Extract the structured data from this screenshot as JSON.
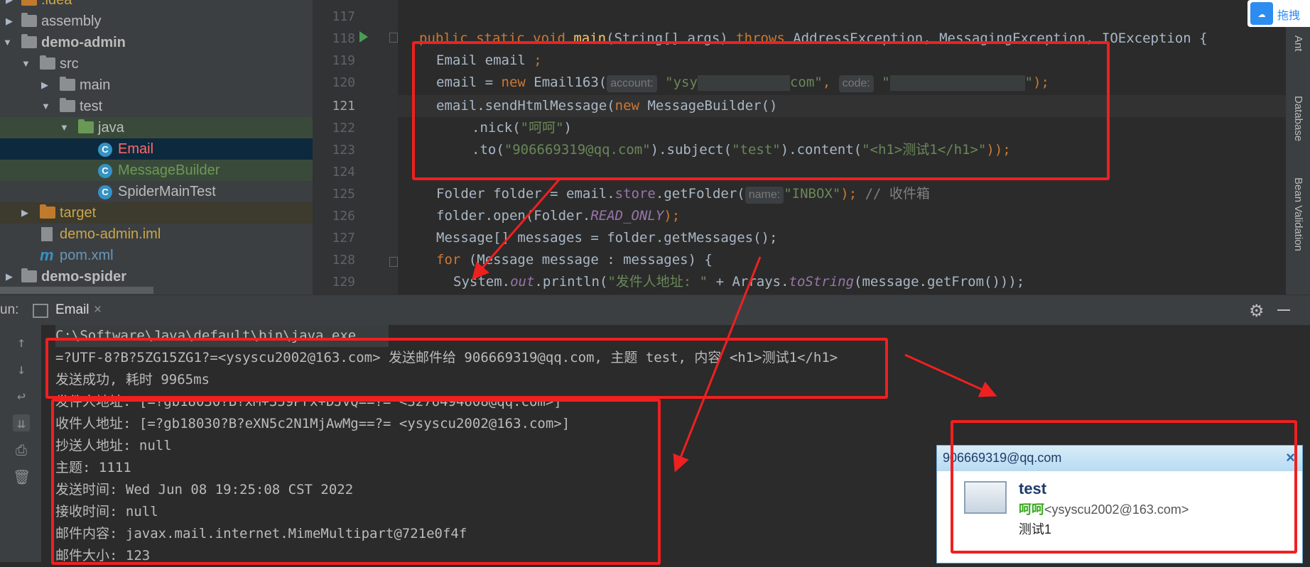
{
  "tree": {
    "items": [
      {
        "label": ".idea"
      },
      {
        "label": "assembly"
      },
      {
        "label": "demo-admin"
      },
      {
        "label": "src"
      },
      {
        "label": "main"
      },
      {
        "label": "test"
      },
      {
        "label": "java"
      },
      {
        "label": "Email"
      },
      {
        "label": "MessageBuilder"
      },
      {
        "label": "SpiderMainTest"
      },
      {
        "label": "target"
      },
      {
        "label": "demo-admin.iml"
      },
      {
        "label": "pom.xml"
      },
      {
        "label": "demo-spider"
      }
    ]
  },
  "gutter": {
    "lines": [
      "117",
      "118",
      "119",
      "120",
      "121",
      "122",
      "123",
      "124",
      "125",
      "126",
      "127",
      "128",
      "129"
    ]
  },
  "code": {
    "l118_kw": "public static void ",
    "l118_fn": "main",
    "l118_rest": "(String[] args) ",
    "l118_throws": "throws ",
    "l118_ex": "AddressException, MessagingException, IOException {",
    "l119": "Email email ",
    "l119_semi": ";",
    "l120_a": "email = ",
    "l120_new": "new ",
    "l120_b": "Email163(",
    "l120_hint1": "account:",
    "l120_s1": "\"ysy",
    "l120_s2": "com\"",
    "l120_c": ", ",
    "l120_hint2": "code:",
    "l120_s3": "\"",
    "l120_s4": "\"",
    "l120_end": ");",
    "l121_a": "email.sendHtmlMessage(",
    "l121_new": "new ",
    "l121_b": "MessageBuilder()",
    "l122_a": ".nick(",
    "l122_s": "\"呵呵\"",
    "l122_b": ")",
    "l123_a": ".to(",
    "l123_s1": "\"906669319@qq.com\"",
    "l123_b": ").subject(",
    "l123_s2": "\"test\"",
    "l123_c": ").content(",
    "l123_s3": "\"<h1>测试1</h1>\"",
    "l123_d": "));",
    "l125_a": "Folder folder = email.",
    "l125_fld": "store",
    "l125_b": ".getFolder(",
    "l125_hint": "name:",
    "l125_s": "\"INBOX\"",
    "l125_c": "); ",
    "l125_cm": "// 收件箱",
    "l126_a": "folder.open(Folder.",
    "l126_it": "READ_ONLY",
    "l126_b": ");",
    "l127": "Message[] messages = folder.getMessages();",
    "l128_kw": "for ",
    "l128_b": "(Message message : messages) {",
    "l129_a": "System.",
    "l129_it": "out",
    "l129_b": ".println(",
    "l129_s": "\"发件人地址: \"",
    "l129_c": " + Arrays.",
    "l129_it2": "toString",
    "l129_d": "(message.getFrom()));"
  },
  "rightstrip": {
    "ant": "Ant",
    "database": "Database",
    "bean": "Bean Validation"
  },
  "baidu": {
    "text": "拖拽"
  },
  "run": {
    "label": "un:",
    "tab": "Email",
    "tab_close": "×"
  },
  "console": {
    "lines": [
      "C:\\Software\\Java\\default\\bin\\java.exe ...",
      "=?UTF-8?B?5ZG15ZG1?=<ysyscu2002@163.com> 发送邮件给 906669319@qq.com, 主题 test, 内容 <h1>测试1</h1>",
      "发送成功, 耗时 9965ms",
      "发件人地址: [=?gb18030?B?xM+359Prx+DJvQ==?= <3276494608@qq.com>]",
      "收件人地址: [=?gb18030?B?eXN5c2N1MjAwMg==?= <ysyscu2002@163.com>]",
      "抄送人地址: null",
      "主题: 1111",
      "发送时间: Wed Jun 08 19:25:08 CST 2022",
      "接收时间: null",
      "邮件内容: javax.mail.internet.MimeMultipart@721e0f4f",
      "邮件大小: 123"
    ]
  },
  "notification": {
    "address": "906669319@qq.com",
    "close": "×",
    "subject": "test",
    "sender_name": "呵呵",
    "sender_email": "<ysyscu2002@163.com>",
    "body": "测试1"
  },
  "colors": {
    "highlight_red": "#ef2020",
    "keyword": "#cc7832",
    "string": "#6a8759"
  }
}
